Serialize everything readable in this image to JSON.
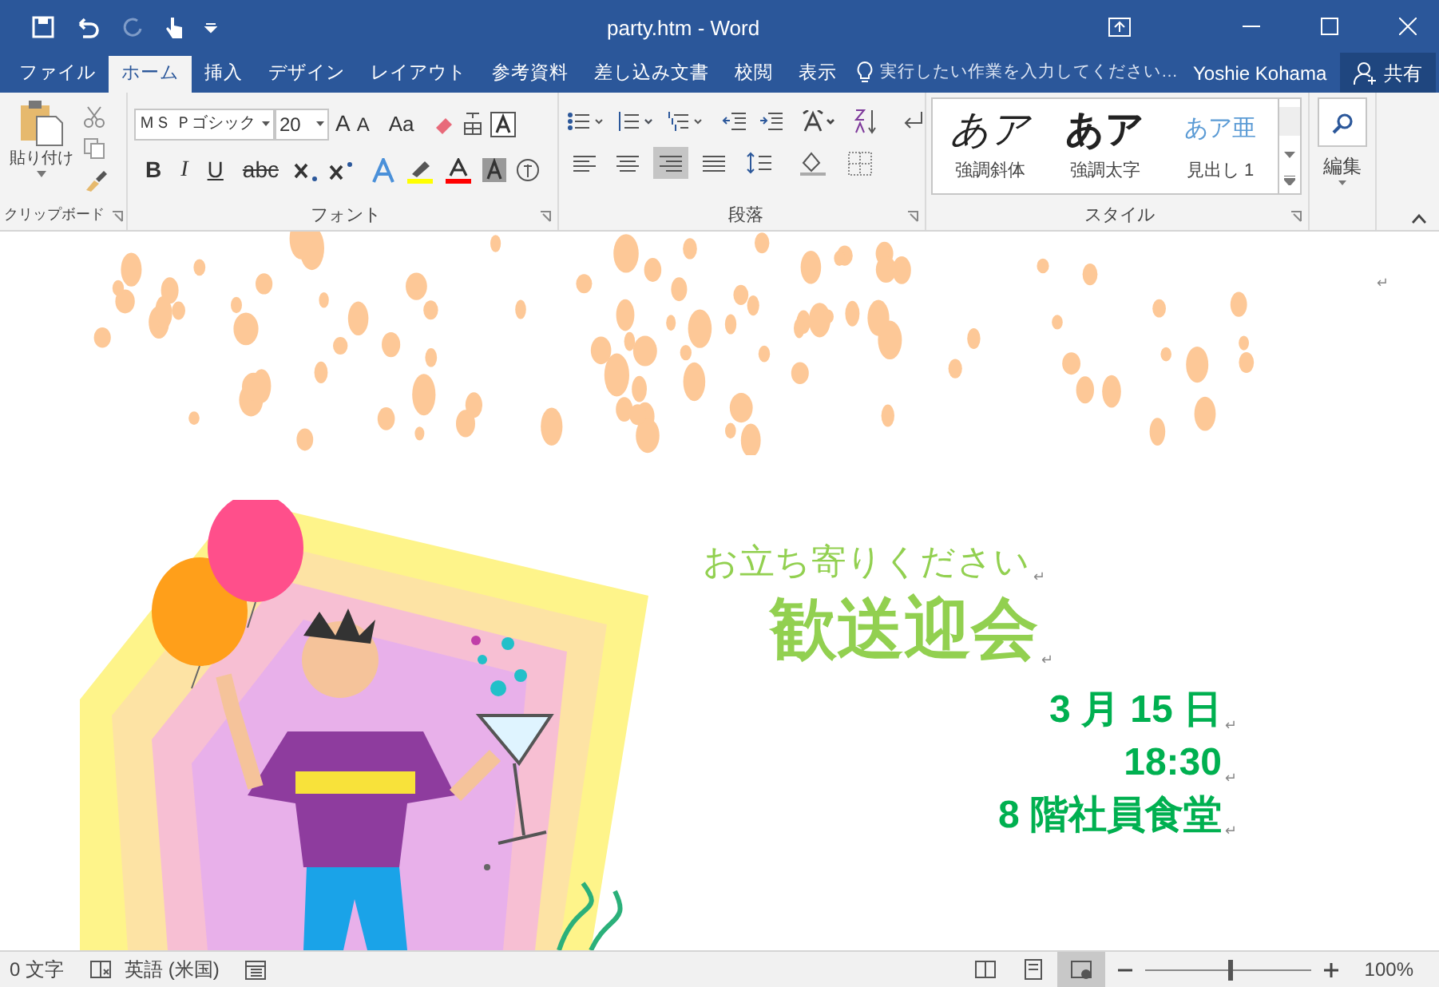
{
  "window": {
    "title": "party.htm - Word"
  },
  "tabs": [
    {
      "label": "ファイル",
      "selected": false
    },
    {
      "label": "ホーム",
      "selected": true
    },
    {
      "label": "挿入",
      "selected": false
    },
    {
      "label": "デザイン",
      "selected": false
    },
    {
      "label": "レイアウト",
      "selected": false
    },
    {
      "label": "参考資料",
      "selected": false
    },
    {
      "label": "差し込み文書",
      "selected": false
    },
    {
      "label": "校閲",
      "selected": false
    },
    {
      "label": "表示",
      "selected": false
    }
  ],
  "tell_me": {
    "placeholder": "実行したい作業を入力してください…"
  },
  "user": "Yoshie Kohama",
  "share": "共有",
  "ribbon": {
    "clipboard": {
      "paste": "貼り付け",
      "label": "クリップボード"
    },
    "font": {
      "name": "ＭＳ Ｐゴシック",
      "size": "20",
      "grow": "A",
      "shrink": "A",
      "case": "Aa",
      "label": "フォント",
      "format_buttons": [
        {
          "text": "B",
          "selected": false
        },
        {
          "text": "I",
          "selected": false
        },
        {
          "text": "U",
          "selected": false
        },
        {
          "text": "abc",
          "selected": false
        }
      ]
    },
    "paragraph": {
      "label": "段落",
      "alignments": [
        {
          "selected": false
        },
        {
          "selected": false
        },
        {
          "selected": true
        },
        {
          "selected": false
        }
      ]
    },
    "styles": {
      "label": "スタイル",
      "items": [
        {
          "preview": "あア",
          "name": "強調斜体",
          "kind": "italic"
        },
        {
          "preview": "あア",
          "name": "強調太字",
          "kind": "bold"
        },
        {
          "preview": "あア亜",
          "name": "見出し 1",
          "kind": "heading"
        }
      ]
    },
    "editing": {
      "label": "編集"
    }
  },
  "document": {
    "header_mark": "↵",
    "lines": [
      {
        "text": "お立ち寄りください",
        "kind": "lead",
        "mark": "↵"
      },
      {
        "text": "歓送迎会",
        "kind": "title",
        "mark": "↵"
      },
      {
        "text": "3 月 15 日",
        "kind": "detail",
        "mark": "↵"
      },
      {
        "text": "18:30",
        "kind": "detail",
        "mark": "↵"
      },
      {
        "text": "8 階社員食堂",
        "kind": "detail",
        "mark": "↵"
      }
    ]
  },
  "status_bar": {
    "words": "0 文字",
    "language": "英語 (米国)",
    "views": [
      {
        "selected": false
      },
      {
        "selected": false
      },
      {
        "selected": true
      }
    ],
    "zoom": {
      "level": 0.5,
      "reading": "100%"
    }
  }
}
